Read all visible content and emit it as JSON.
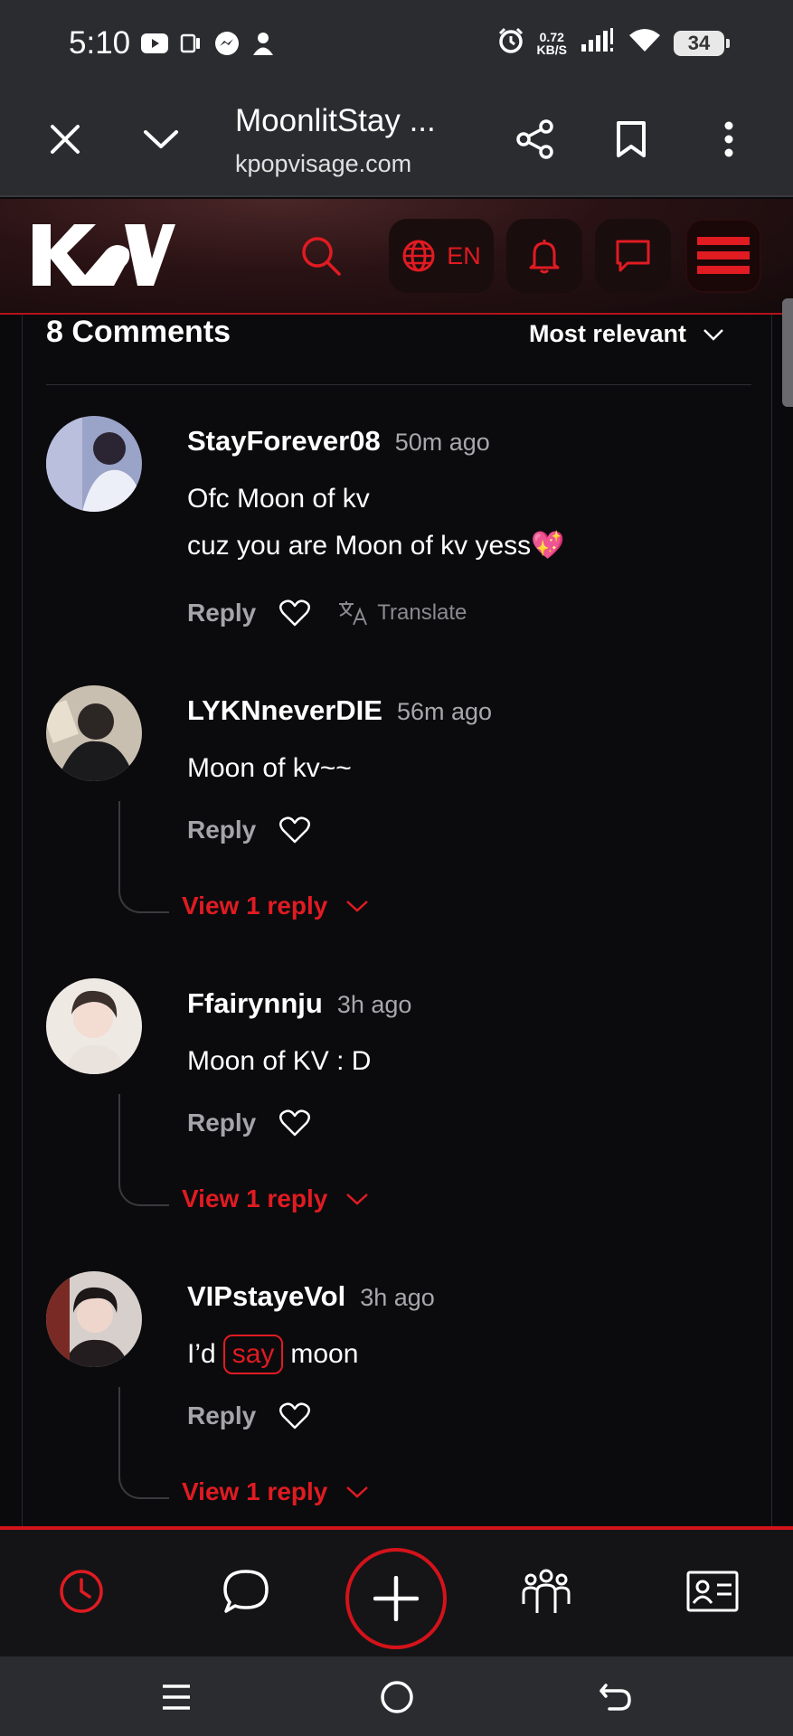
{
  "status_bar": {
    "time": "5:10",
    "net_speed_value": "0.72",
    "net_speed_unit": "KB/S",
    "battery": "34"
  },
  "browser": {
    "page_title": "MoonlitStay ...",
    "url": "kpopvisage.com"
  },
  "site_header": {
    "logo_text": "KV",
    "language": "EN",
    "accent_color": "#e01b22"
  },
  "comments_section": {
    "count_label": "8 Comments",
    "sort_label": "Most relevant",
    "comments": [
      {
        "user": "StayForever08",
        "time": "50m ago",
        "lines": [
          "Ofc Moon of kv",
          "cuz you are Moon of kv yess💖"
        ],
        "reply_label": "Reply",
        "translate_label": "Translate"
      },
      {
        "user": "LYKNneverDIE",
        "time": "56m ago",
        "lines": [
          "Moon of kv~~"
        ],
        "reply_label": "Reply",
        "view_replies_label": "View 1 reply"
      },
      {
        "user": "Ffairynnju",
        "time": "3h ago",
        "lines": [
          "Moon of KV : D"
        ],
        "reply_label": "Reply",
        "view_replies_label": "View 1 reply"
      },
      {
        "user": "VIPstayeVol",
        "time": "3h ago",
        "text_before": "I’d",
        "highlight": "say",
        "text_after": "moon",
        "reply_label": "Reply",
        "view_replies_label": "View 1 reply"
      }
    ]
  },
  "bottom_nav": {
    "items": [
      "clock-icon",
      "chat-icon",
      "plus-icon",
      "community-icon",
      "profile-card-icon"
    ]
  }
}
